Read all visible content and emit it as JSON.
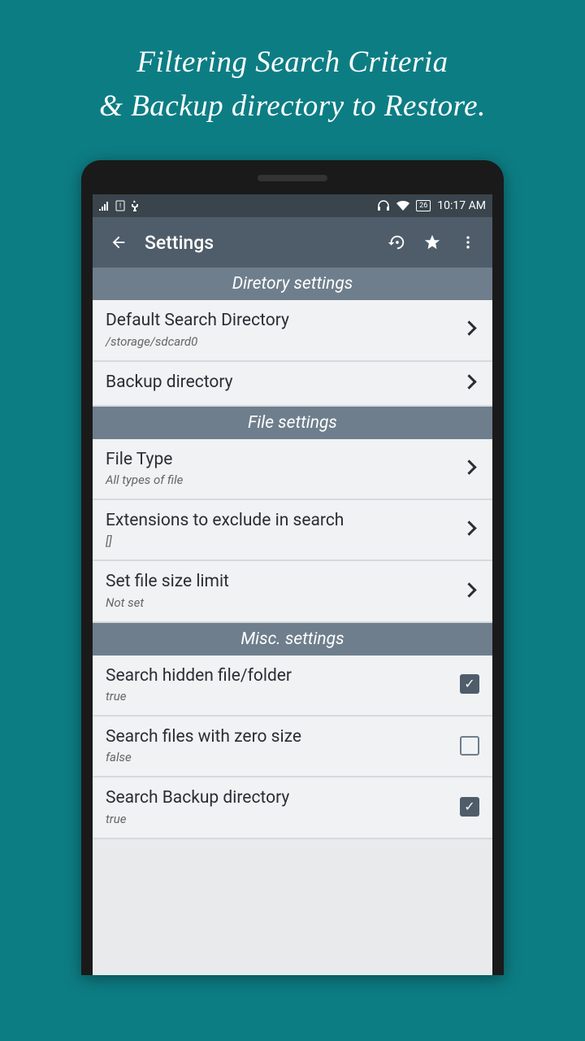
{
  "promo": {
    "line1": "Filtering Search Criteria",
    "line2": "& Backup directory to Restore."
  },
  "statusBar": {
    "battery": "26",
    "time": "10:17 AM"
  },
  "appBar": {
    "title": "Settings"
  },
  "sections": {
    "directory": {
      "header": "Diretory settings",
      "items": [
        {
          "title": "Default Search Directory",
          "sub": "/storage/sdcard0"
        },
        {
          "title": "Backup directory",
          "sub": ""
        }
      ]
    },
    "file": {
      "header": "File settings",
      "items": [
        {
          "title": "File Type",
          "sub": "All types of file"
        },
        {
          "title": "Extensions to exclude in search",
          "sub": "[]"
        },
        {
          "title": "Set file size limit",
          "sub": "Not set"
        }
      ]
    },
    "misc": {
      "header": "Misc. settings",
      "items": [
        {
          "title": "Search hidden file/folder",
          "sub": "true",
          "checked": true
        },
        {
          "title": "Search files with zero size",
          "sub": "false",
          "checked": false
        },
        {
          "title": "Search Backup directory",
          "sub": "true",
          "checked": true
        }
      ]
    }
  }
}
